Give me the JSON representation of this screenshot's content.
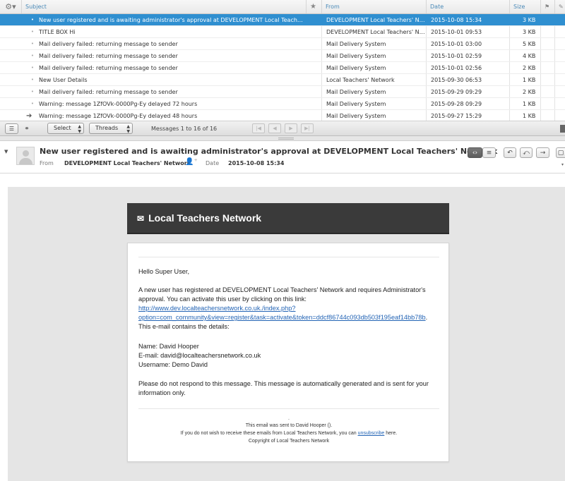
{
  "list": {
    "columns": {
      "subject": "Subject",
      "from": "From",
      "date": "Date",
      "size": "Size"
    },
    "rows": [
      {
        "subject": "New user registered and is awaiting administrator's approval at DEVELOPMENT Local Teache…",
        "from": "DEVELOPMENT Local Teachers' N…",
        "date": "2015-10-08 15:34",
        "size": "3 KB",
        "selected": true
      },
      {
        "subject": "TITLE BOX Hi",
        "from": "DEVELOPMENT Local Teachers' N…",
        "date": "2015-10-01 09:53",
        "size": "3 KB"
      },
      {
        "subject": "Mail delivery failed: returning message to sender",
        "from": "Mail Delivery System",
        "date": "2015-10-01 03:00",
        "size": "5 KB"
      },
      {
        "subject": "Mail delivery failed: returning message to sender",
        "from": "Mail Delivery System",
        "date": "2015-10-01 02:59",
        "size": "4 KB"
      },
      {
        "subject": "Mail delivery failed: returning message to sender",
        "from": "Mail Delivery System",
        "date": "2015-10-01 02:56",
        "size": "2 KB"
      },
      {
        "subject": "New User Details",
        "from": "Local Teachers' Network",
        "date": "2015-09-30 06:53",
        "size": "1 KB"
      },
      {
        "subject": "Mail delivery failed: returning message to sender",
        "from": "Mail Delivery System",
        "date": "2015-09-29 09:29",
        "size": "2 KB"
      },
      {
        "subject": "Warning: message 1ZfOVk-0000Pg-Ey delayed 72 hours",
        "from": "Mail Delivery System",
        "date": "2015-09-28 09:29",
        "size": "1 KB"
      },
      {
        "subject": "Warning: message 1ZfOVk-0000Pg-Ey delayed 48 hours",
        "from": "Mail Delivery System",
        "date": "2015-09-27 15:29",
        "size": "1 KB",
        "forwarded": true
      }
    ]
  },
  "toolbar": {
    "select_label": "Select",
    "threads_label": "Threads",
    "count_text": "Messages 1 to 16 of 16"
  },
  "message": {
    "subject": "New user registered and is awaiting administrator's approval at DEVELOPMENT Local Teachers' Network",
    "from_label": "From",
    "from_value": "DEVELOPMENT Local Teachers' Network",
    "date_label": "Date",
    "date_value": "2015-10-08 15:34"
  },
  "email": {
    "banner_title": "Local Teachers Network",
    "greeting": "Hello Super User,",
    "para1": "A new user has registered at DEVELOPMENT Local Teachers' Network and requires Administrator's approval. You can activate this user by clicking on this link:",
    "link_line1": "http://www.dev.localteachersnetwork.co.uk./index.php?",
    "link_line2": "option=com_community&view=register&task=activate&token=ddcf86744c093db503f195eaf14bb78b",
    "link_tail": ".",
    "details_intro": "This e-mail contains the details:",
    "name_line": "Name: David Hooper",
    "email_line": "E-mail: david@localteachersnetwork.co.uk",
    "username_line": "Username: Demo David",
    "notice": "Please do not respond to this message. This message is automatically generated and is sent for your information only.",
    "footer_dot": ".",
    "footer_sent": "This email was sent to David Hooper ().",
    "footer_unsub_pre": "If you do not wish to receive these emails from Local Teachers Network, you can ",
    "footer_unsub_link": "unsubscribe",
    "footer_unsub_post": " here.",
    "footer_copyright": "Copyright of Local Teachers Network"
  },
  "colors": {
    "selection": "#2f8fd0",
    "header_text": "#4a8ab8",
    "link": "#2364b5",
    "banner": "#3a3a3a"
  }
}
